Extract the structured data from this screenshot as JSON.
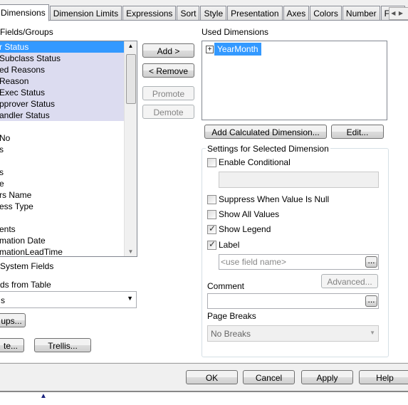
{
  "tabs": [
    "Dimensions",
    "Dimension Limits",
    "Expressions",
    "Sort",
    "Style",
    "Presentation",
    "Axes",
    "Colors",
    "Number",
    "Font"
  ],
  "left": {
    "label": "Fields/Groups",
    "items": [
      "r Status",
      "Subclass Status",
      "ed Reasons",
      "Reason",
      " Exec Status",
      "pprover Status",
      "andler Status",
      "",
      "No",
      "s",
      "",
      "s",
      "e",
      "rs Name",
      "ess Type",
      "",
      "ents",
      "mation Date",
      "mationLeadTime"
    ],
    "system_fields": "System Fields",
    "from_table": "ds from Table",
    "table_select": "s",
    "groups_btn": "ups...",
    "edit_btn": "te...",
    "trellis_btn": "Trellis..."
  },
  "middle": {
    "add": "Add >",
    "remove": "< Remove",
    "promote": "Promote",
    "demote": "Demote"
  },
  "right": {
    "used_label": "Used Dimensions",
    "used": [
      "YearMonth"
    ],
    "add_calc": "Add Calculated Dimension...",
    "edit": "Edit...",
    "settings_title": "Settings for Selected Dimension",
    "enable_conditional": "Enable Conditional",
    "suppress_null": "Suppress When Value Is Null",
    "show_all": "Show All Values",
    "show_legend": "Show Legend",
    "label": "Label",
    "label_placeholder": "<use field name>",
    "advanced": "Advanced...",
    "comment": "Comment",
    "page_breaks": "Page Breaks",
    "page_breaks_value": "No Breaks",
    "checks": {
      "enable_conditional": false,
      "suppress_null": false,
      "show_all": false,
      "show_legend": true,
      "label": true
    }
  },
  "footer": {
    "ok": "OK",
    "cancel": "Cancel",
    "apply": "Apply",
    "help": "Help"
  }
}
